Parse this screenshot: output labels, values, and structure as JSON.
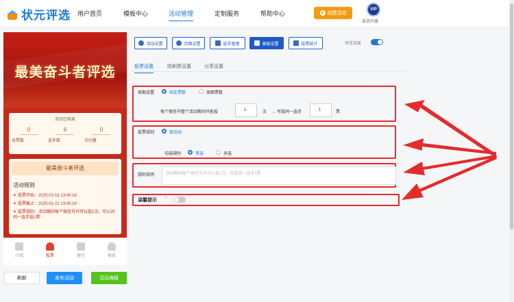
{
  "header": {
    "logo_text": "状元评选",
    "nav": [
      "用户首页",
      "模板中心",
      "活动管理",
      "定制服务",
      "帮助中心"
    ],
    "create_button": "创建活动",
    "vip_badge": "VIP",
    "vip_label": "会员升级"
  },
  "phone": {
    "banner_title": "最美奋斗者评选",
    "stats_header": "活动已结束",
    "stats": [
      {
        "value": "0",
        "label": "总票数"
      },
      {
        "value": "6",
        "label": "选手数"
      },
      {
        "value": "0",
        "label": "访问量"
      }
    ],
    "card_title": "最美奋斗者评选",
    "rules_heading": "活动规则",
    "rules": [
      "投票开始：2025-01-16 13:45:16",
      "投票截止：2025-01-22 13:45:16",
      "投票规则：活动期间每个微信号只可以投1次，可以对同一选手投1票"
    ],
    "tabs": [
      "介绍",
      "投票",
      "排行",
      "报名"
    ]
  },
  "actions": {
    "refresh": "刷新",
    "publish": "发布活动",
    "poster": "活动海报"
  },
  "toolbar": {
    "buttons": [
      "活动设置",
      "页面设置",
      "选手管理",
      "高级设置",
      "投票统计"
    ],
    "preview_label": "预览效果",
    "preview_on": true
  },
  "subtabs": [
    "投票设置",
    "防刷票设置",
    "分享设置"
  ],
  "vote_settings": {
    "cycle_label": "周期设置",
    "cycle_options": [
      "固定票数",
      "周期票数"
    ],
    "cycle_selected": 0,
    "limit_text_1": "每个微信号整个活动期间只能投",
    "limit_value_1": "1",
    "limit_unit_1": "次",
    "limit_text_2": "，可投同一选手",
    "limit_value_2": "1",
    "limit_unit_2": "票",
    "rule_label": "投票规则",
    "rule_option": "按活动",
    "check_label": "勾选规则",
    "check_options": [
      "单选",
      "多选"
    ],
    "check_selected": 0,
    "desc_label": "规则说明",
    "desc_placeholder": "活动期间每个微信号只可以投1次，可投同一选手1票",
    "tip_label": "温馨提示",
    "tip_on": false
  },
  "colors": {
    "brand_blue": "#1e78d2",
    "accent_orange": "#f39c12",
    "annotation_red": "#e42b2b",
    "banner_red": "#c62a1b"
  }
}
